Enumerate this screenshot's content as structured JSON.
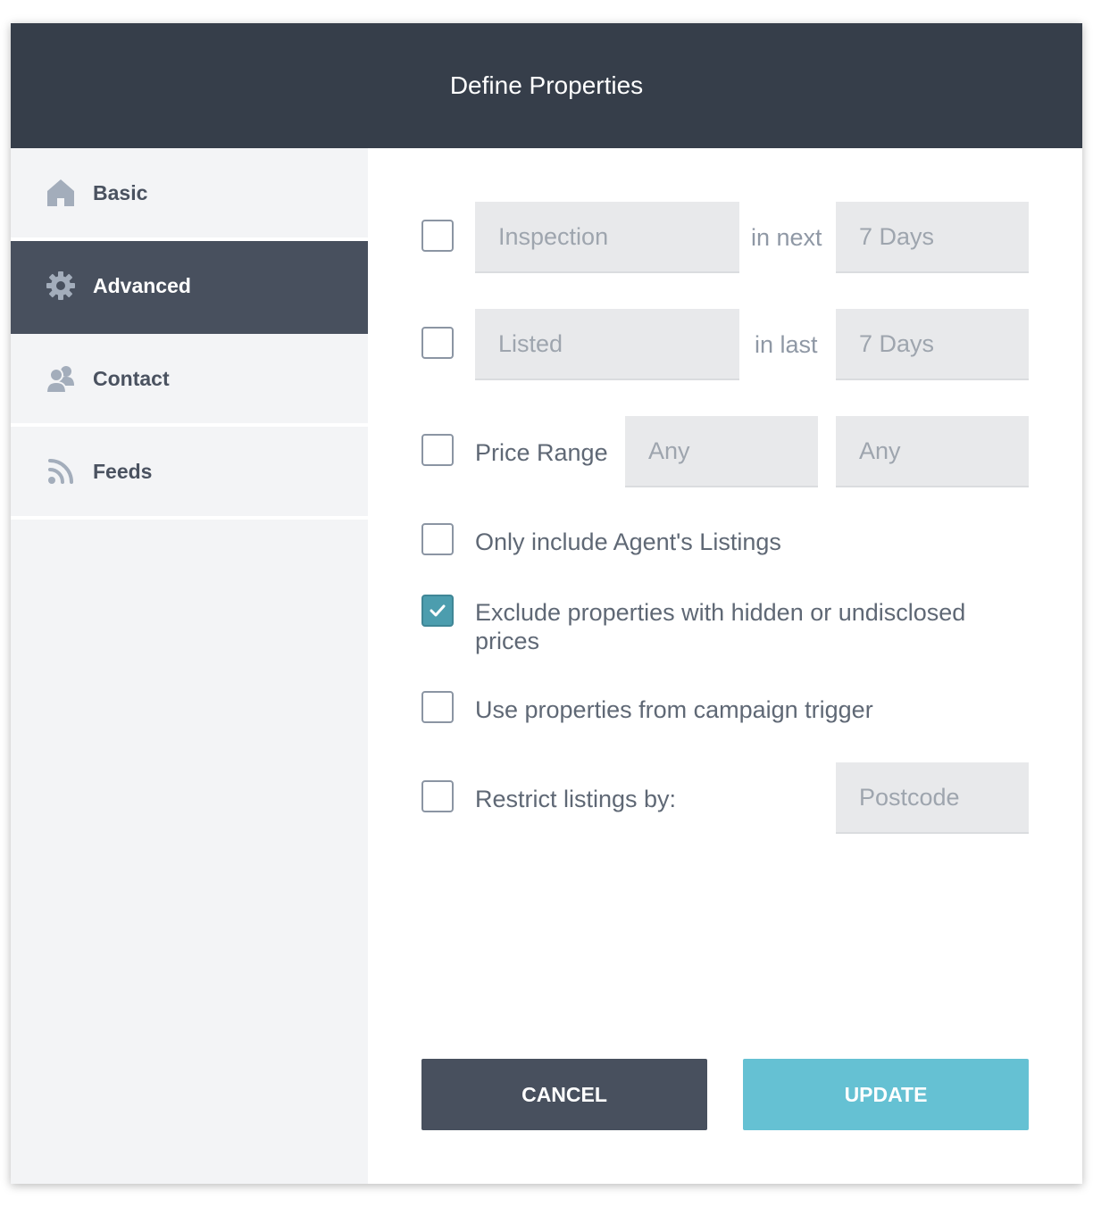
{
  "dialog": {
    "title": "Define Properties"
  },
  "sidebar": {
    "items": [
      {
        "label": "Basic",
        "icon": "home-icon",
        "active": false
      },
      {
        "label": "Advanced",
        "icon": "gear-icon",
        "active": true
      },
      {
        "label": "Contact",
        "icon": "users-icon",
        "active": false
      },
      {
        "label": "Feeds",
        "icon": "rss-icon",
        "active": false
      }
    ]
  },
  "options": {
    "inspection": {
      "checked": false,
      "select_value": "Inspection",
      "connector": "in next",
      "period_value": "7 Days"
    },
    "listed": {
      "checked": false,
      "select_value": "Listed",
      "connector": "in last",
      "period_value": "7 Days"
    },
    "price_range": {
      "checked": false,
      "label": "Price Range",
      "min_value": "Any",
      "max_value": "Any"
    },
    "agent_listings": {
      "checked": false,
      "label": "Only include Agent's Listings"
    },
    "exclude_hidden_prices": {
      "checked": true,
      "label": "Exclude properties with hidden or undisclosed prices"
    },
    "campaign_trigger": {
      "checked": false,
      "label": "Use properties from campaign trigger"
    },
    "restrict_listings": {
      "checked": false,
      "label": "Restrict listings by:",
      "select_value": "Postcode"
    }
  },
  "buttons": {
    "cancel_label": "CANCEL",
    "update_label": "UPDATE"
  },
  "colors": {
    "header_bg": "#363e4a",
    "sidebar_active_bg": "#48505e",
    "checkbox_checked": "#4c9dae",
    "update_button": "#65c1d3",
    "cancel_button": "#48505e"
  }
}
